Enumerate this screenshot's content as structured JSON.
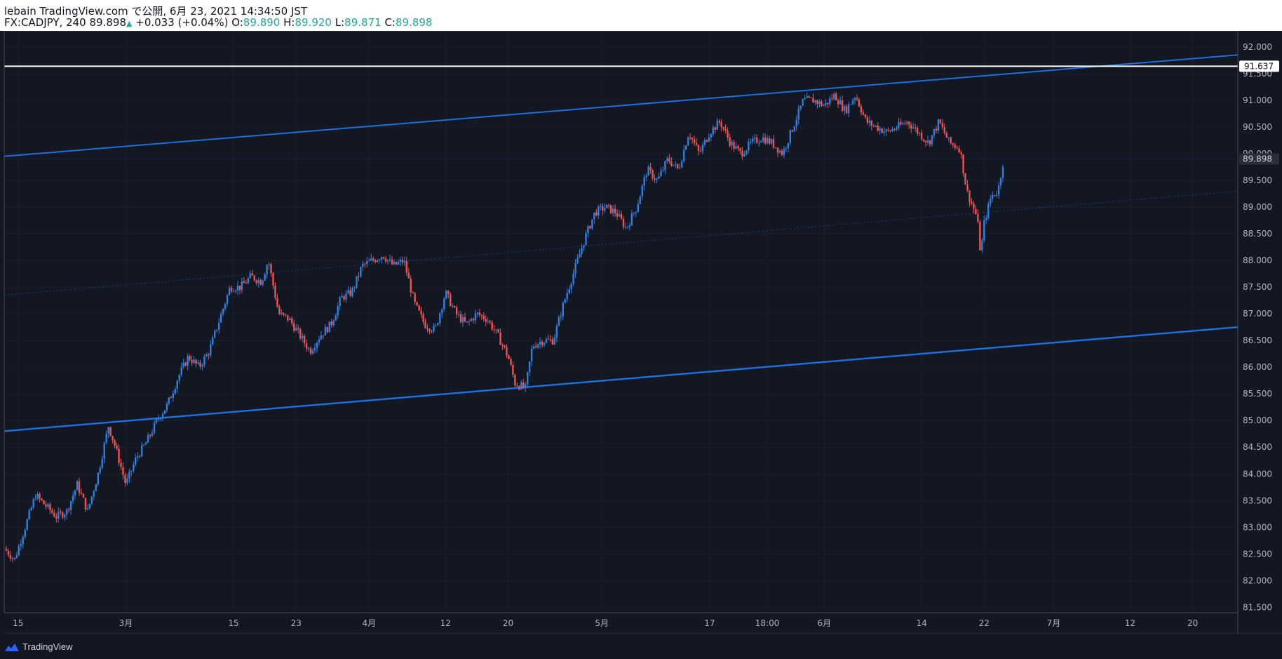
{
  "header": {
    "publisher_line": "lebain TradingView.com で公開, 6月 23, 2021 14:34:50 JST",
    "symbol": "FX:CADJPY, 240",
    "last": "89.898",
    "change": "+0.033 (+0.04%)",
    "o_label": "O:",
    "o_value": "89.890",
    "h_label": "H:",
    "h_value": "89.920",
    "l_label": "L:",
    "l_value": "89.871",
    "c_label": "C:",
    "c_value": "89.898"
  },
  "footer": {
    "brand": "TradingView"
  },
  "colors": {
    "background": "#131722",
    "up": "#2962ff",
    "up_candle": "#2f7fe0",
    "down_candle": "#ef5350",
    "channel": "#1e6fd9",
    "horizontal_line": "#ffffff",
    "grid": "#1c2030"
  },
  "chart_data": {
    "type": "candlestick",
    "symbol": "FX:CADJPY",
    "interval": "240",
    "ylim": [
      81.5,
      92.0
    ],
    "y_ticks": [
      81.5,
      82.0,
      82.5,
      83.0,
      83.5,
      84.0,
      84.5,
      85.0,
      85.5,
      86.0,
      86.5,
      87.0,
      87.5,
      88.0,
      88.5,
      89.0,
      89.5,
      90.0,
      90.5,
      91.0,
      91.5,
      92.0
    ],
    "y_tick_labels": [
      "81.500",
      "82.000",
      "82.500",
      "83.000",
      "83.500",
      "84.000",
      "84.500",
      "85.000",
      "85.500",
      "86.000",
      "86.500",
      "87.000",
      "87.500",
      "88.000",
      "88.500",
      "89.000",
      "89.500",
      "90.000",
      "90.500",
      "91.000",
      "91.500",
      "92.000"
    ],
    "x_ticks": [
      {
        "label": "15",
        "t": 0.2
      },
      {
        "label": "3月",
        "t": 1.75
      },
      {
        "label": "15",
        "t": 3.3
      },
      {
        "label": "23",
        "t": 4.2
      },
      {
        "label": "4月",
        "t": 5.25
      },
      {
        "label": "12",
        "t": 6.35
      },
      {
        "label": "20",
        "t": 7.25
      },
      {
        "label": "5月",
        "t": 8.6
      },
      {
        "label": "17",
        "t": 10.15
      },
      {
        "label": "18:00",
        "t": 10.98
      },
      {
        "label": "6月",
        "t": 11.8
      },
      {
        "label": "14",
        "t": 13.2
      },
      {
        "label": "22",
        "t": 14.1
      },
      {
        "label": "7月",
        "t": 15.1
      },
      {
        "label": "12",
        "t": 16.2
      },
      {
        "label": "20",
        "t": 17.1
      }
    ],
    "x_range": [
      0,
      17.75
    ],
    "close_path": [
      [
        0.0,
        82.6
      ],
      [
        0.15,
        82.4
      ],
      [
        0.3,
        83.0
      ],
      [
        0.45,
        83.6
      ],
      [
        0.6,
        83.4
      ],
      [
        0.75,
        83.2
      ],
      [
        0.9,
        83.3
      ],
      [
        1.05,
        83.8
      ],
      [
        1.2,
        83.3
      ],
      [
        1.35,
        84.0
      ],
      [
        1.5,
        84.9
      ],
      [
        1.6,
        84.5
      ],
      [
        1.75,
        83.8
      ],
      [
        1.9,
        84.3
      ],
      [
        2.05,
        84.6
      ],
      [
        2.2,
        85.0
      ],
      [
        2.35,
        85.3
      ],
      [
        2.5,
        85.8
      ],
      [
        2.65,
        86.2
      ],
      [
        2.8,
        86.0
      ],
      [
        2.95,
        86.3
      ],
      [
        3.1,
        86.9
      ],
      [
        3.25,
        87.5
      ],
      [
        3.4,
        87.5
      ],
      [
        3.55,
        87.7
      ],
      [
        3.7,
        87.6
      ],
      [
        3.8,
        88.0
      ],
      [
        3.95,
        87.0
      ],
      [
        4.1,
        86.9
      ],
      [
        4.25,
        86.6
      ],
      [
        4.4,
        86.3
      ],
      [
        4.55,
        86.6
      ],
      [
        4.7,
        86.8
      ],
      [
        4.85,
        87.3
      ],
      [
        5.0,
        87.4
      ],
      [
        5.15,
        87.9
      ],
      [
        5.3,
        88.0
      ],
      [
        5.45,
        88.1
      ],
      [
        5.6,
        87.9
      ],
      [
        5.75,
        88.0
      ],
      [
        5.9,
        87.2
      ],
      [
        6.05,
        86.8
      ],
      [
        6.2,
        86.7
      ],
      [
        6.35,
        87.4
      ],
      [
        6.5,
        87.0
      ],
      [
        6.65,
        86.8
      ],
      [
        6.8,
        87.0
      ],
      [
        6.95,
        86.9
      ],
      [
        7.1,
        86.6
      ],
      [
        7.25,
        86.2
      ],
      [
        7.35,
        85.7
      ],
      [
        7.5,
        85.6
      ],
      [
        7.6,
        86.4
      ],
      [
        7.75,
        86.5
      ],
      [
        7.9,
        86.5
      ],
      [
        8.05,
        87.2
      ],
      [
        8.2,
        87.8
      ],
      [
        8.35,
        88.4
      ],
      [
        8.5,
        88.9
      ],
      [
        8.65,
        89.0
      ],
      [
        8.8,
        88.9
      ],
      [
        8.95,
        88.6
      ],
      [
        9.1,
        89.0
      ],
      [
        9.25,
        89.7
      ],
      [
        9.4,
        89.5
      ],
      [
        9.55,
        89.9
      ],
      [
        9.7,
        89.7
      ],
      [
        9.85,
        90.4
      ],
      [
        10.0,
        90.0
      ],
      [
        10.15,
        90.4
      ],
      [
        10.3,
        90.6
      ],
      [
        10.45,
        90.2
      ],
      [
        10.6,
        90.0
      ],
      [
        10.75,
        90.2
      ],
      [
        10.9,
        90.3
      ],
      [
        11.05,
        90.2
      ],
      [
        11.2,
        90.0
      ],
      [
        11.35,
        90.5
      ],
      [
        11.5,
        91.0
      ],
      [
        11.65,
        91.0
      ],
      [
        11.8,
        90.9
      ],
      [
        11.95,
        91.1
      ],
      [
        12.1,
        90.8
      ],
      [
        12.25,
        91.1
      ],
      [
        12.4,
        90.6
      ],
      [
        12.55,
        90.5
      ],
      [
        12.7,
        90.4
      ],
      [
        12.85,
        90.5
      ],
      [
        13.0,
        90.6
      ],
      [
        13.15,
        90.4
      ],
      [
        13.3,
        90.2
      ],
      [
        13.45,
        90.6
      ],
      [
        13.6,
        90.2
      ],
      [
        13.75,
        90.1
      ],
      [
        13.85,
        89.3
      ],
      [
        14.0,
        88.8
      ],
      [
        14.05,
        88.1
      ],
      [
        14.1,
        88.7
      ],
      [
        14.2,
        89.2
      ],
      [
        14.3,
        89.3
      ],
      [
        14.38,
        89.9
      ]
    ],
    "channel_upper": {
      "from": [
        0.0,
        89.95
      ],
      "to": [
        17.75,
        91.85
      ]
    },
    "channel_mid": {
      "from": [
        0.0,
        87.35
      ],
      "to": [
        17.75,
        89.3
      ]
    },
    "channel_lower": {
      "from": [
        0.0,
        84.8
      ],
      "to": [
        17.75,
        86.75
      ]
    },
    "horizontal_line": {
      "value": 91.637,
      "label": "91.637"
    },
    "last_price": {
      "value": 89.898,
      "label": "89.898"
    }
  }
}
